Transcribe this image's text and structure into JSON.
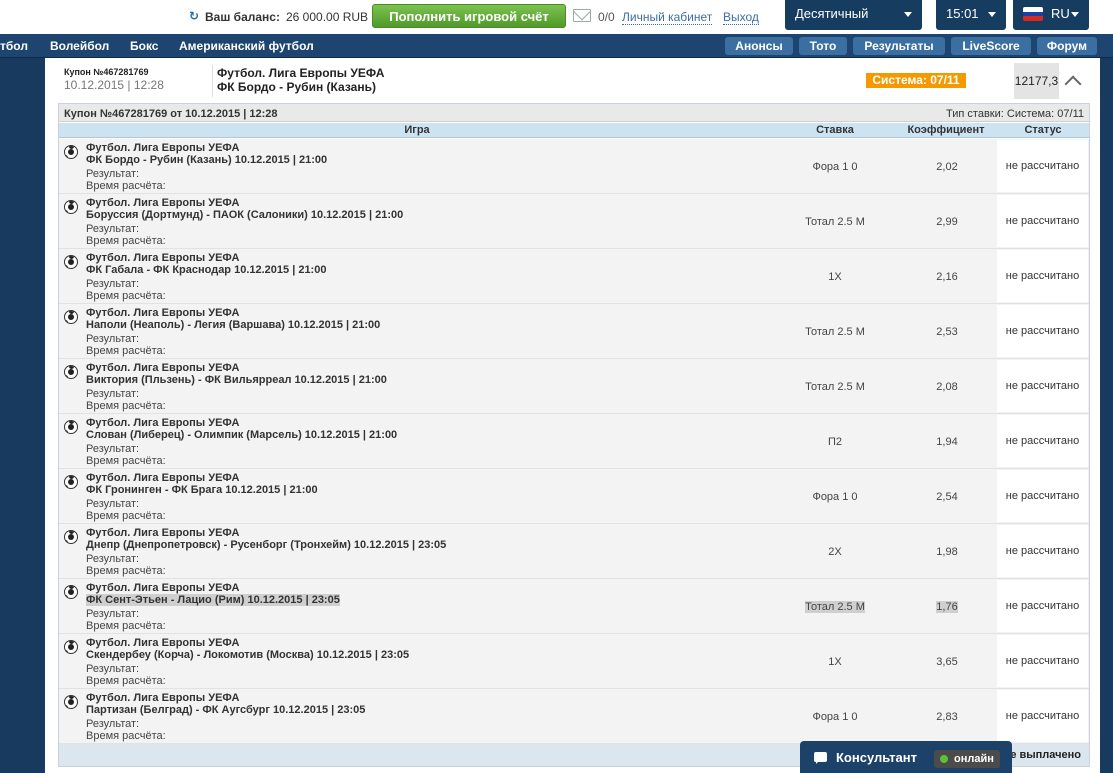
{
  "topbar": {
    "balance_label": "Ваш баланс:",
    "balance_value": "26 000.00 RUB",
    "topup_label": "Пополнить игровой счёт",
    "mail_count": "0/0",
    "cabinet_label": "Личный кабинет",
    "logout_label": "Выход",
    "odds_format": "Десятичный",
    "time": "15:01",
    "language": "RU"
  },
  "nav": {
    "sports": [
      "тбол",
      "Волейбол",
      "Бокс",
      "Американский футбол"
    ],
    "links": [
      "Анонсы",
      "Тото",
      "Результаты",
      "LiveScore",
      "Форум"
    ]
  },
  "coupon_summary": {
    "number": "Купон №467281769",
    "date": "10.12.2015 | 12:28",
    "league": "Футбол. Лига Европы УЕФА",
    "match": "ФК Бордо - Рубин (Казань)",
    "system_badge": "Система: 07/11",
    "amount": "12177,3"
  },
  "coupon": {
    "title": "Купон №467281769 от 10.12.2015 | 12:28",
    "bet_type": "Тип ставки: Система: 07/11",
    "columns": [
      "Игра",
      "Ставка",
      "Коэффициент",
      "Статус"
    ],
    "result_label": "Результат:",
    "calc_time_label": "Время расчёта:",
    "rows": [
      {
        "league": "Футбол. Лига Европы УЕФА",
        "match": "ФК Бордо - Рубин (Казань) 10.12.2015 | 21:00",
        "bet": "Фора 1 0",
        "odds": "2,02",
        "status": "не рассчитано"
      },
      {
        "league": "Футбол. Лига Европы УЕФА",
        "match": "Боруссия (Дортмунд) - ПАОК (Салоники) 10.12.2015 | 21:00",
        "bet": "Тотал 2.5 М",
        "odds": "2,99",
        "status": "не рассчитано"
      },
      {
        "league": "Футбол. Лига Европы УЕФА",
        "match": "ФК Габала - ФК Краснодар 10.12.2015 | 21:00",
        "bet": "1X",
        "odds": "2,16",
        "status": "не рассчитано"
      },
      {
        "league": "Футбол. Лига Европы УЕФА",
        "match": "Наполи (Неаполь) - Легия (Варшава) 10.12.2015 | 21:00",
        "bet": "Тотал 2.5 М",
        "odds": "2,53",
        "status": "не рассчитано"
      },
      {
        "league": "Футбол. Лига Европы УЕФА",
        "match": "Виктория (Пльзень) - ФК Вильярреал 10.12.2015 | 21:00",
        "bet": "Тотал 2.5 М",
        "odds": "2,08",
        "status": "не рассчитано"
      },
      {
        "league": "Футбол. Лига Европы УЕФА",
        "match": "Слован (Либерец) - Олимпик (Марсель) 10.12.2015 | 21:00",
        "bet": "П2",
        "odds": "1,94",
        "status": "не рассчитано"
      },
      {
        "league": "Футбол. Лига Европы УЕФА",
        "match": "ФК Гронинген - ФК Брага 10.12.2015 | 21:00",
        "bet": "Фора 1 0",
        "odds": "2,54",
        "status": "не рассчитано"
      },
      {
        "league": "Футбол. Лига Европы УЕФА",
        "match": "Днепр (Днепропетровск) - Русенборг (Тронхейм) 10.12.2015 | 23:05",
        "bet": "2X",
        "odds": "1,98",
        "status": "не рассчитано"
      },
      {
        "league": "Футбол. Лига Европы УЕФА",
        "match": "ФК Сент-Этьен - Лацио (Рим) 10.12.2015 | 23:05",
        "bet": "Тотал 2.5 М",
        "odds": "1,76",
        "status": "не рассчитано",
        "highlighted": true
      },
      {
        "league": "Футбол. Лига Европы УЕФА",
        "match": "Скендербеу (Корча) - Локомотив (Москва) 10.12.2015 | 23:05",
        "bet": "1X",
        "odds": "3,65",
        "status": "не рассчитано"
      },
      {
        "league": "Футбол. Лига Европы УЕФА",
        "match": "Партизан (Белград) - ФК Аугсбург 10.12.2015 | 23:05",
        "bet": "Фора 1 0",
        "odds": "2,83",
        "status": "не рассчитано"
      }
    ],
    "footer_status": "не выплачено"
  },
  "consultant": {
    "label": "Консультант",
    "online": "онлайн"
  },
  "colors": {
    "header_dark": "#163c60",
    "topup_green": "#5aa832",
    "system_orange": "#f49a00",
    "column_header": "#cde3f2"
  }
}
